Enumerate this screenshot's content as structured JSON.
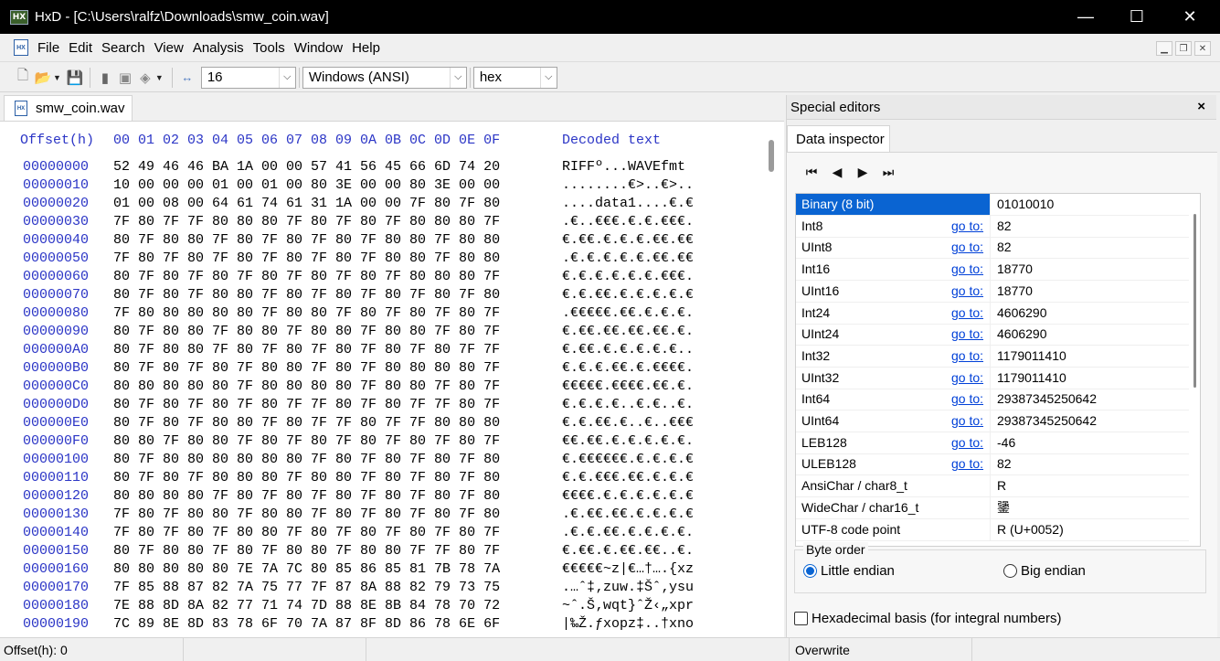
{
  "window": {
    "title": "HxD - [C:\\Users\\ralfz\\Downloads\\smw_coin.wav]",
    "minimize": "—",
    "maximize": "☐",
    "close": "✕"
  },
  "menu": [
    "File",
    "Edit",
    "Search",
    "View",
    "Analysis",
    "Tools",
    "Window",
    "Help"
  ],
  "toolbar": {
    "bytes_per_row": "16",
    "charset": "Windows (ANSI)",
    "offset_base": "hex"
  },
  "document_tab": {
    "label": "smw_coin.wav"
  },
  "hex_view": {
    "offset_header": "Offset(h)",
    "column_header": "00 01 02 03 04 05 06 07 08 09 0A 0B 0C 0D 0E 0F",
    "decoded_header": "Decoded text",
    "rows": [
      {
        "offset": "00000000",
        "bytes": "52 49 46 46 BA 1A 00 00 57 41 56 45 66 6D 74 20",
        "text": "RIFFº...WAVEfmt "
      },
      {
        "offset": "00000010",
        "bytes": "10 00 00 00 01 00 01 00 80 3E 00 00 80 3E 00 00",
        "text": "........€>..€>.."
      },
      {
        "offset": "00000020",
        "bytes": "01 00 08 00 64 61 74 61 31 1A 00 00 7F 80 7F 80",
        "text": "....data1....€.€"
      },
      {
        "offset": "00000030",
        "bytes": "7F 80 7F 7F 80 80 80 7F 80 7F 80 7F 80 80 80 7F",
        "text": ".€..€€€.€.€.€€€."
      },
      {
        "offset": "00000040",
        "bytes": "80 7F 80 80 7F 80 7F 80 7F 80 7F 80 80 7F 80 80",
        "text": "€.€€.€.€.€.€€.€€"
      },
      {
        "offset": "00000050",
        "bytes": "7F 80 7F 80 7F 80 7F 80 7F 80 7F 80 80 7F 80 80",
        "text": ".€.€.€.€.€.€€.€€"
      },
      {
        "offset": "00000060",
        "bytes": "80 7F 80 7F 80 7F 80 7F 80 7F 80 7F 80 80 80 7F",
        "text": "€.€.€.€.€.€.€€€."
      },
      {
        "offset": "00000070",
        "bytes": "80 7F 80 7F 80 80 7F 80 7F 80 7F 80 7F 80 7F 80",
        "text": "€.€.€€.€.€.€.€.€"
      },
      {
        "offset": "00000080",
        "bytes": "7F 80 80 80 80 80 7F 80 80 7F 80 7F 80 7F 80 7F",
        "text": ".€€€€€.€€.€.€.€."
      },
      {
        "offset": "00000090",
        "bytes": "80 7F 80 80 7F 80 80 7F 80 80 7F 80 80 7F 80 7F",
        "text": "€.€€.€€.€€.€€.€."
      },
      {
        "offset": "000000A0",
        "bytes": "80 7F 80 80 7F 80 7F 80 7F 80 7F 80 7F 80 7F 7F",
        "text": "€.€€.€.€.€.€.€.."
      },
      {
        "offset": "000000B0",
        "bytes": "80 7F 80 7F 80 7F 80 80 7F 80 7F 80 80 80 80 7F",
        "text": "€.€.€.€€.€.€€€€."
      },
      {
        "offset": "000000C0",
        "bytes": "80 80 80 80 80 7F 80 80 80 80 7F 80 80 7F 80 7F",
        "text": "€€€€€.€€€€.€€.€."
      },
      {
        "offset": "000000D0",
        "bytes": "80 7F 80 7F 80 7F 80 7F 7F 80 7F 80 7F 7F 80 7F",
        "text": "€.€.€.€..€.€..€."
      },
      {
        "offset": "000000E0",
        "bytes": "80 7F 80 7F 80 80 7F 80 7F 7F 80 7F 7F 80 80 80",
        "text": "€.€.€€.€..€..€€€"
      },
      {
        "offset": "000000F0",
        "bytes": "80 80 7F 80 80 7F 80 7F 80 7F 80 7F 80 7F 80 7F",
        "text": "€€.€€.€.€.€.€.€."
      },
      {
        "offset": "00000100",
        "bytes": "80 7F 80 80 80 80 80 80 7F 80 7F 80 7F 80 7F 80",
        "text": "€.€€€€€€.€.€.€.€"
      },
      {
        "offset": "00000110",
        "bytes": "80 7F 80 7F 80 80 80 7F 80 80 7F 80 7F 80 7F 80",
        "text": "€.€.€€€.€€.€.€.€"
      },
      {
        "offset": "00000120",
        "bytes": "80 80 80 80 7F 80 7F 80 7F 80 7F 80 7F 80 7F 80",
        "text": "€€€€.€.€.€.€.€.€"
      },
      {
        "offset": "00000130",
        "bytes": "7F 80 7F 80 80 7F 80 80 7F 80 7F 80 7F 80 7F 80",
        "text": ".€.€€.€€.€.€.€.€"
      },
      {
        "offset": "00000140",
        "bytes": "7F 80 7F 80 7F 80 80 7F 80 7F 80 7F 80 7F 80 7F",
        "text": ".€.€.€€.€.€.€.€."
      },
      {
        "offset": "00000150",
        "bytes": "80 7F 80 80 7F 80 7F 80 80 7F 80 80 7F 7F 80 7F",
        "text": "€.€€.€.€€.€€..€."
      },
      {
        "offset": "00000160",
        "bytes": "80 80 80 80 80 7E 7A 7C 80 85 86 85 81 7B 78 7A",
        "text": "€€€€€~z|€…†….{xz"
      },
      {
        "offset": "00000170",
        "bytes": "7F 85 88 87 82 7A 75 77 7F 87 8A 88 82 79 73 75",
        "text": ".…ˆ‡‚zuw.‡Šˆ‚ysu"
      },
      {
        "offset": "00000180",
        "bytes": "7E 88 8D 8A 82 77 71 74 7D 88 8E 8B 84 78 70 72",
        "text": "~ˆ.Š‚wqt}ˆŽ‹„xpr"
      },
      {
        "offset": "00000190",
        "bytes": "7C 89 8E 8D 83 78 6F 70 7A 87 8F 8D 86 78 6E 6F",
        "text": "|‰Ž.ƒxopz‡..†xno"
      }
    ]
  },
  "special_editors": {
    "title": "Special editors",
    "close": "×",
    "tab": "Data inspector",
    "goto_label": "go to:",
    "rows": [
      {
        "name": "Binary (8 bit)",
        "value": "01010010",
        "goto": false,
        "selected": true
      },
      {
        "name": "Int8",
        "value": "82",
        "goto": true
      },
      {
        "name": "UInt8",
        "value": "82",
        "goto": true
      },
      {
        "name": "Int16",
        "value": "18770",
        "goto": true
      },
      {
        "name": "UInt16",
        "value": "18770",
        "goto": true
      },
      {
        "name": "Int24",
        "value": "4606290",
        "goto": true
      },
      {
        "name": "UInt24",
        "value": "4606290",
        "goto": true
      },
      {
        "name": "Int32",
        "value": "1179011410",
        "goto": true
      },
      {
        "name": "UInt32",
        "value": "1179011410",
        "goto": true
      },
      {
        "name": "Int64",
        "value": "29387345250642",
        "goto": true
      },
      {
        "name": "UInt64",
        "value": "29387345250642",
        "goto": true
      },
      {
        "name": "LEB128",
        "value": "-46",
        "goto": true
      },
      {
        "name": "ULEB128",
        "value": "82",
        "goto": true
      },
      {
        "name": "AnsiChar / char8_t",
        "value": "R",
        "goto": false
      },
      {
        "name": "WideChar / char16_t",
        "value": "䥒",
        "goto": false
      },
      {
        "name": "UTF-8 code point",
        "value": "R (U+0052)",
        "goto": false
      }
    ],
    "byte_order": {
      "legend": "Byte order",
      "little": "Little endian",
      "big": "Big endian",
      "selected": "little"
    },
    "hex_basis": "Hexadecimal basis (for integral numbers)"
  },
  "statusbar": {
    "offset": "Offset(h): 0",
    "mode": "Overwrite"
  },
  "colors": {
    "offset_blue": "#2b35c6",
    "selection": "#0a64d2",
    "link": "#0040d8"
  }
}
